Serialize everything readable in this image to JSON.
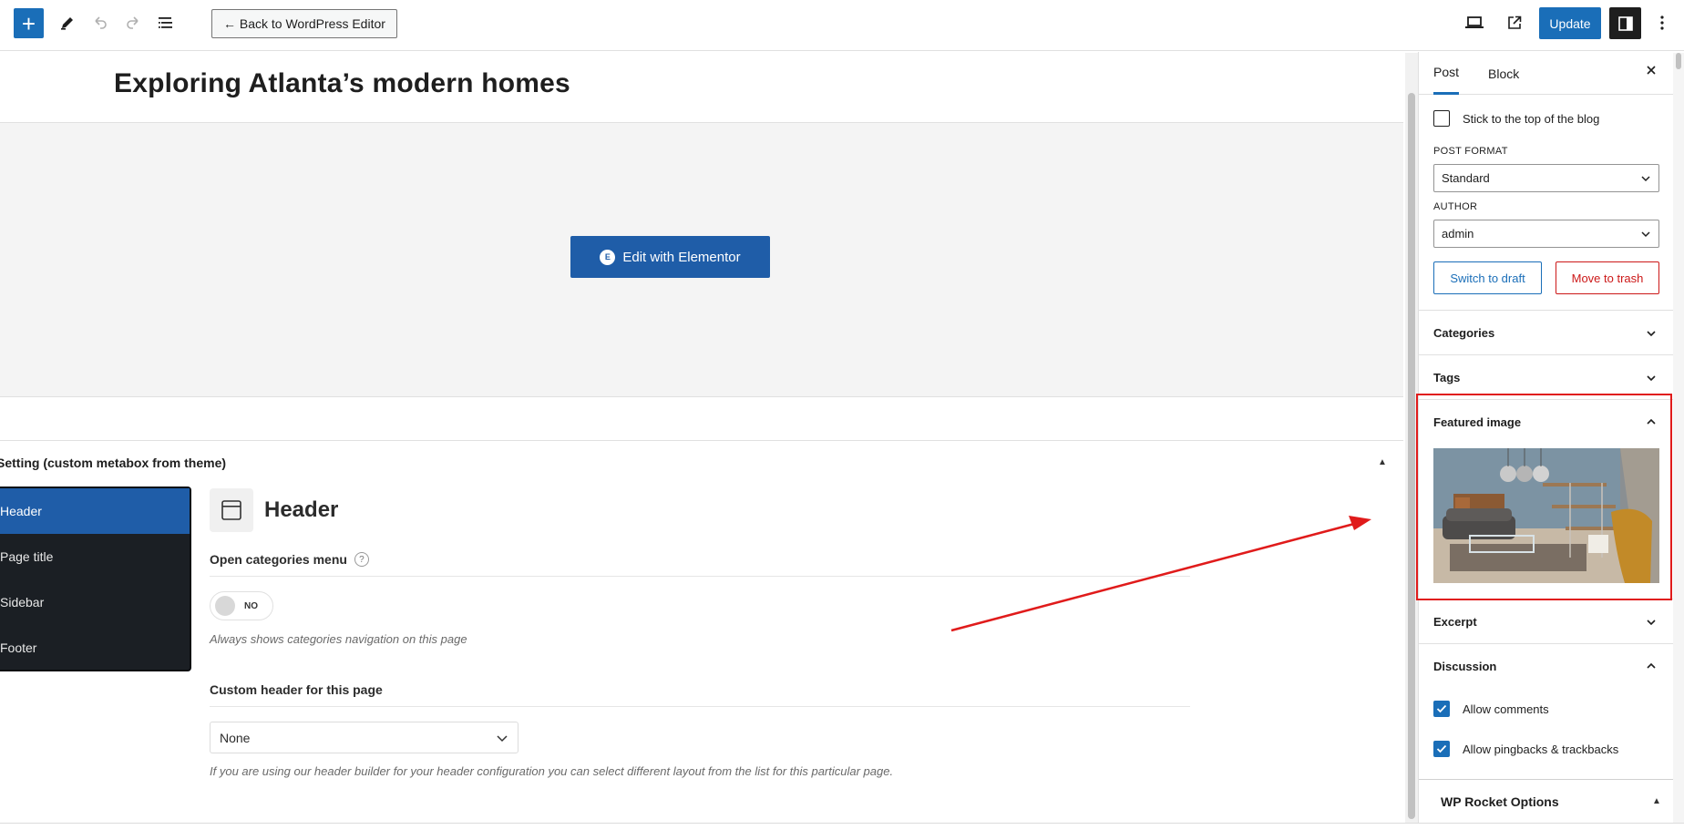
{
  "topbar": {
    "back_label": "← Back to WordPress Editor",
    "update_label": "Update",
    "icons": [
      "plus-icon",
      "pencil-icon",
      "undo-icon",
      "redo-icon",
      "list-view-icon",
      "desktop-preview-icon",
      "external-link-icon",
      "sidebar-toggle-icon",
      "more-options-icon"
    ]
  },
  "editor": {
    "post_title": "Exploring Atlanta’s modern homes",
    "edit_elementor_label": "Edit with Elementor",
    "elementor_logo": "E"
  },
  "metabox": {
    "title": "Setting (custom metabox from theme)",
    "nav": [
      {
        "label": "Header",
        "active": true
      },
      {
        "label": "Page title",
        "active": false
      },
      {
        "label": "Sidebar",
        "active": false
      },
      {
        "label": "Footer",
        "active": false
      }
    ],
    "section_title": "Header",
    "open_categories": {
      "label": "Open categories menu",
      "help": "?",
      "toggle_text": "NO",
      "desc": "Always shows categories navigation on this page"
    },
    "custom_header": {
      "label": "Custom header for this page",
      "value": "None",
      "desc": "If you are using our header builder for your header configuration you can select different layout from the list for this particular page."
    }
  },
  "settings": {
    "tabs": [
      {
        "label": "Post",
        "active": true
      },
      {
        "label": "Block",
        "active": false
      }
    ],
    "sticky_label": "Stick to the top of the blog",
    "post_format_label": "POST FORMAT",
    "post_format_value": "Standard",
    "author_label": "AUTHOR",
    "author_value": "admin",
    "switch_draft_label": "Switch to draft",
    "move_trash_label": "Move to trash",
    "panels": {
      "categories": "Categories",
      "tags": "Tags",
      "featured_image": "Featured image",
      "excerpt": "Excerpt",
      "discussion": "Discussion",
      "wp_rocket": "WP Rocket Options"
    },
    "allow_comments": "Allow comments",
    "allow_pingbacks": "Allow pingbacks & trackbacks"
  },
  "colors": {
    "accent": "#1a6eb8",
    "elementor": "#1f5da8",
    "annotation": "#e01b1b",
    "trash": "#cc1818"
  }
}
